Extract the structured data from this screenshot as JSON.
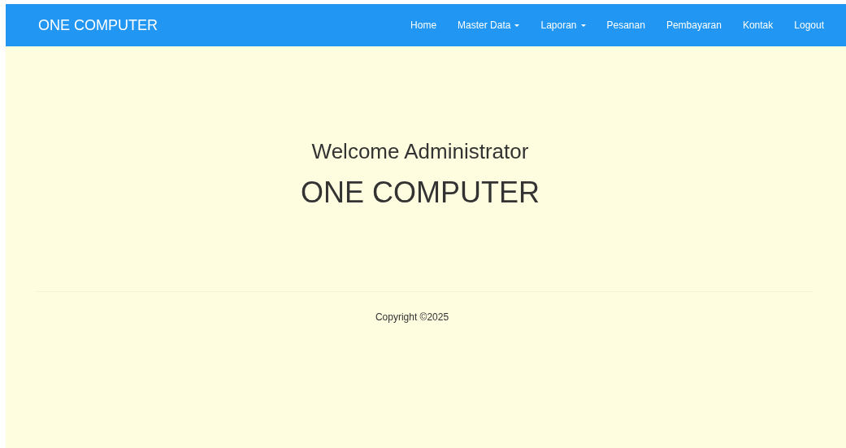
{
  "navbar": {
    "brand": "ONE COMPUTER",
    "items": [
      {
        "label": "Home",
        "kind": "link"
      },
      {
        "label": "Master Data",
        "kind": "dropdown"
      },
      {
        "label": "Laporan",
        "kind": "dropdown"
      },
      {
        "label": "Pesanan",
        "kind": "link"
      },
      {
        "label": "Pembayaran",
        "kind": "link"
      },
      {
        "label": "Kontak",
        "kind": "link"
      },
      {
        "label": "Logout",
        "kind": "link"
      }
    ]
  },
  "hero": {
    "greeting": "Welcome Administrator",
    "title": "ONE COMPUTER"
  },
  "footer": {
    "copyright": "Copyright ©2025"
  }
}
